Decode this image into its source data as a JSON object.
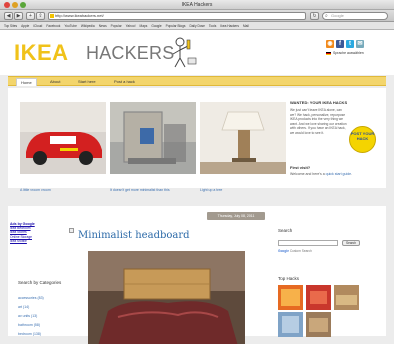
{
  "window": {
    "title": "IKEA Hackers"
  },
  "toolbar": {
    "back": "◀",
    "forward": "▶",
    "url": "http://www.ikeahackers.net/",
    "search_placeholder": "Google"
  },
  "bookmarks": [
    "Top Sites",
    "Apple",
    "iCloud",
    "Facebook",
    "YouTube",
    "Wikipedia",
    "News",
    "Popular",
    "Yahoo!",
    "Maps",
    "Google",
    "Popular Blogs",
    "Daily Dose",
    "Tools",
    "Ikea Hackers",
    "Mail"
  ],
  "header": {
    "logo_ikea": "IKEA",
    "logo_hackers": "HACKERS",
    "language_label": "Sprache auswählen"
  },
  "nav": [
    "Home",
    "About",
    "Start here",
    "Post a hack"
  ],
  "featured": [
    {
      "caption": "A little vroom vroom"
    },
    {
      "caption": "It doesn't get more minimalist than this"
    },
    {
      "caption": "Light up a tree"
    }
  ],
  "wanted": {
    "title": "WANTED: YOUR IKEA HACKS",
    "text": "We just can't leave IKEA alone, can we? We hack, personalize, repurpose IKEA products into the very thing we want. And we love sharing our creation with others. If you have an IKEA hack, we would love to see it.",
    "badge": "POST YOUR HACK"
  },
  "first_visit": {
    "title": "First visit?",
    "text_prefix": "Welcome and here's a ",
    "link": "quick start guide",
    "text_suffix": "."
  },
  "ads": {
    "title": "Ads by Google",
    "links": [
      "Ikea Bedroom",
      "Ikea Stores",
      "Online Storage",
      "Ikea Mobile"
    ]
  },
  "categories": {
    "title": "Search by Categories",
    "items": [
      "accessories (83)",
      "art (14)",
      "av units (13)",
      "bathroom (58)",
      "bedroom (138)"
    ]
  },
  "post": {
    "date": "Thursday, July 08, 2011",
    "title": "Minimalist headboard"
  },
  "search": {
    "label": "Search",
    "button": "Search",
    "powered": "Custom Search"
  },
  "top_hacks": {
    "title": "Top Hacks"
  },
  "colors": {
    "brand_yellow": "#f0c21a",
    "nav_yellow": "#f3d56c",
    "link_blue": "#3a6fb0",
    "title_blue": "#2c6aa8"
  }
}
